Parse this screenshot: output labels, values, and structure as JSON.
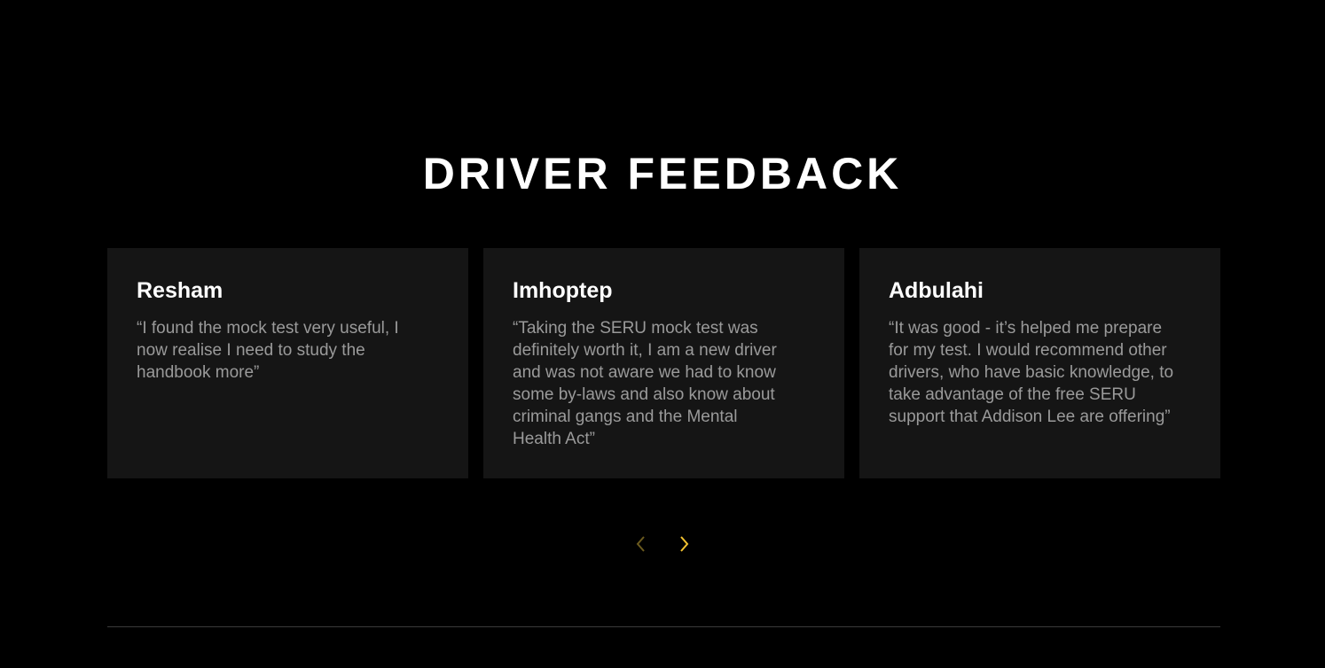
{
  "section": {
    "title": "DRIVER FEEDBACK"
  },
  "testimonials": [
    {
      "name": "Resham",
      "quote": "“I found the mock test very useful, I now realise I need to study the handbook more”"
    },
    {
      "name": "Imhoptep",
      "quote": "“Taking the SERU mock test was definitely worth it, I am a new driver and was not aware we had to know some by-laws and also know about criminal gangs and the Mental Health Act”"
    },
    {
      "name": "Adbulahi",
      "quote": "“It was good - it’s helped me prepare for my test. I would recommend other drivers, who have basic knowledge, to take advantage of the free SERU support that Addison Lee are offering”"
    }
  ],
  "carousel": {
    "prev_icon": "chevron-left-icon",
    "next_icon": "chevron-right-icon",
    "prev_color": "#6b5a1e",
    "next_color": "#f2c230"
  },
  "colors": {
    "background": "#000000",
    "card_background": "#151515",
    "quote_text": "#9a9a9a",
    "divider": "#3a3a3a"
  }
}
